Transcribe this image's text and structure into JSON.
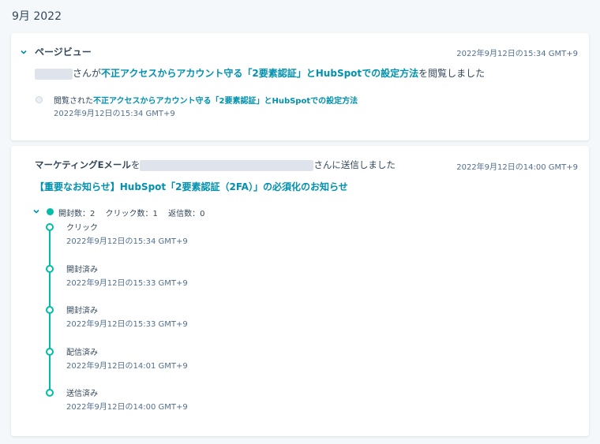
{
  "month_header": "9月 2022",
  "pageview": {
    "title": "ページビュー",
    "timestamp": "2022年9月12日の15:34 GMT+9",
    "summary_suffix": "さんが",
    "link_text": "不正アクセスからアカウント守る「2要素認証」とHubSpotでの設定方法",
    "summary_end": "を閲覧しました",
    "detail_prefix": "閲覧された",
    "detail_link": "不正アクセスからアカウント守る「2要素認証」とHubSpotでの設定方法",
    "detail_timestamp": "2022年9月12日の15:34 GMT+9"
  },
  "email": {
    "title_prefix": "マーケティングEメール",
    "title_mid": "を",
    "title_suffix": "さんに送信しました",
    "timestamp": "2022年9月12日の14:00 GMT+9",
    "subject": "【重要なお知らせ】HubSpot「2要素認証（2FA）」の必須化のお知らせ",
    "stats": "開封数：2　 クリック数：1　 返信数：0",
    "events": [
      {
        "label": "クリック",
        "time": "2022年9月12日の15:34 GMT+9"
      },
      {
        "label": "開封済み",
        "time": "2022年9月12日の15:33 GMT+9"
      },
      {
        "label": "開封済み",
        "time": "2022年9月12日の15:33 GMT+9"
      },
      {
        "label": "配信済み",
        "time": "2022年9月12日の14:01 GMT+9"
      },
      {
        "label": "送信済み",
        "time": "2022年9月12日の14:00 GMT+9"
      }
    ]
  },
  "colors": {
    "link": "#0091ae",
    "accent": "#00bda5",
    "text": "#33475b"
  }
}
